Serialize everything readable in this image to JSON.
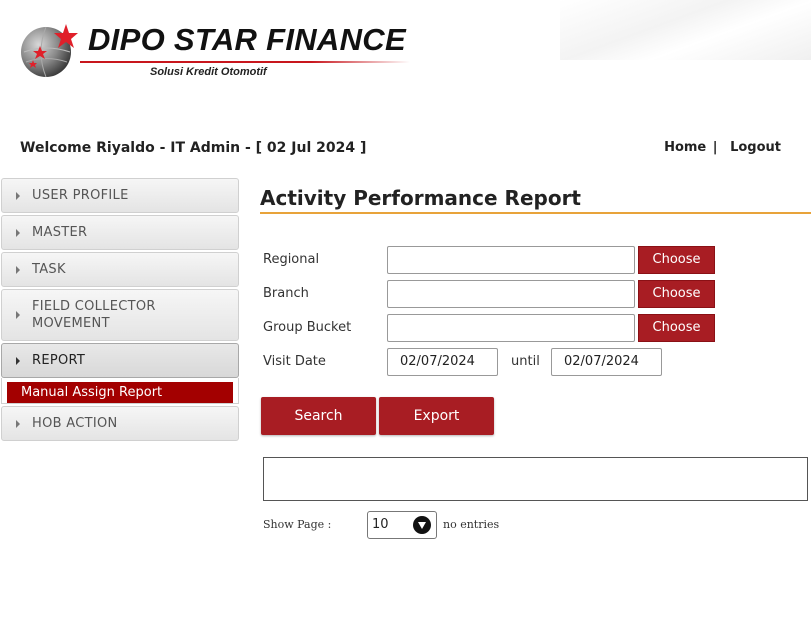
{
  "brand": {
    "name": "DIPO STAR FINANCE",
    "tagline": "Solusi Kredit Otomotif",
    "logo_icon": "globe-star-logo",
    "accent_red": "#c8161d"
  },
  "welcome": {
    "text": "Welcome Riyaldo - IT Admin - [ 02 Jul 2024 ]"
  },
  "top_links": {
    "home": "Home",
    "separator": "|",
    "logout": "Logout"
  },
  "sidebar": {
    "items": [
      {
        "label": "USER PROFILE",
        "icon": "caret-right-icon"
      },
      {
        "label": "MASTER",
        "icon": "caret-right-icon"
      },
      {
        "label": "TASK",
        "icon": "caret-right-icon"
      },
      {
        "label": "FIELD COLLECTOR MOVEMENT",
        "icon": "caret-right-icon"
      },
      {
        "label": "REPORT",
        "icon": "caret-right-icon",
        "active": true
      },
      {
        "label": "HOB ACTION",
        "icon": "caret-right-icon"
      }
    ],
    "report_submenu": [
      "Manual Assign Report"
    ]
  },
  "page": {
    "title": "Activity Performance Report",
    "title_underline_color": "#e8a33a"
  },
  "form": {
    "regional": {
      "label": "Regional",
      "value": "",
      "button": "Choose"
    },
    "branch": {
      "label": "Branch",
      "value": "",
      "button": "Choose"
    },
    "group_bucket": {
      "label": "Group Bucket",
      "value": "",
      "button": "Choose"
    },
    "visit_date": {
      "label": "Visit Date",
      "from": "02/07/2024",
      "until_label": "until",
      "to": "02/07/2024"
    }
  },
  "actions": {
    "search": "Search",
    "export": "Export",
    "button_color": "#a81d23"
  },
  "table_controls": {
    "show_page_label": "Show Page :",
    "page_size": "10",
    "no_entries": "no entries",
    "select_icon": "chevron-down-circle-icon"
  }
}
